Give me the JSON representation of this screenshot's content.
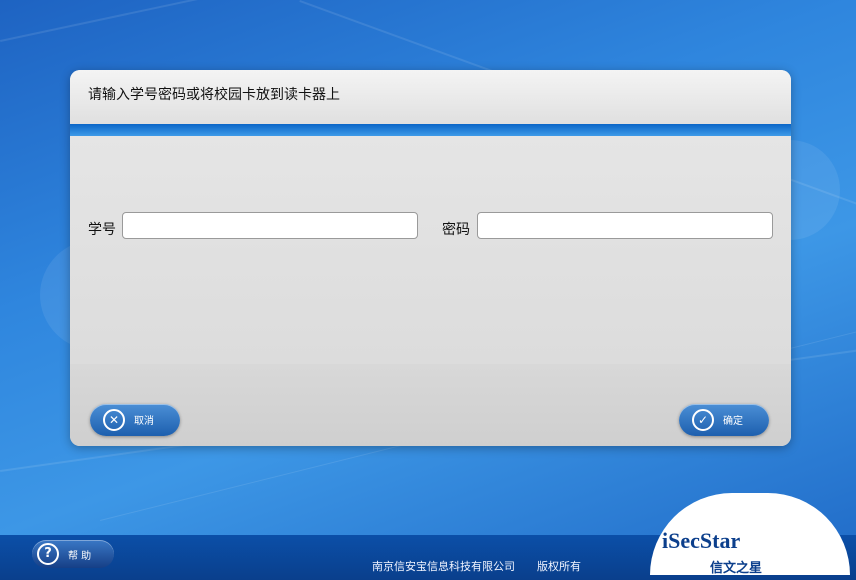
{
  "dialog": {
    "title": "请输入学号密码或将校园卡放到读卡器上"
  },
  "form": {
    "student_id_label": "学号",
    "student_id_value": "",
    "password_label": "密码",
    "password_value": ""
  },
  "buttons": {
    "cancel_label": "取消",
    "cancel_icon": "cancel-x-icon",
    "confirm_label": "确定",
    "confirm_icon": "check-icon"
  },
  "footer": {
    "help_label": "帮 助",
    "help_icon": "question-icon",
    "copyright": "南京信安宝信息科技有限公司　　版权所有"
  },
  "logo": {
    "brand": "iSecStar",
    "brand_cn": "信文之星"
  },
  "colors": {
    "background_blue": "#2f86de",
    "accent_band": "#0a66c8",
    "button_blue": "#1d5fae",
    "dialog_gray": "#e8e8e8"
  }
}
